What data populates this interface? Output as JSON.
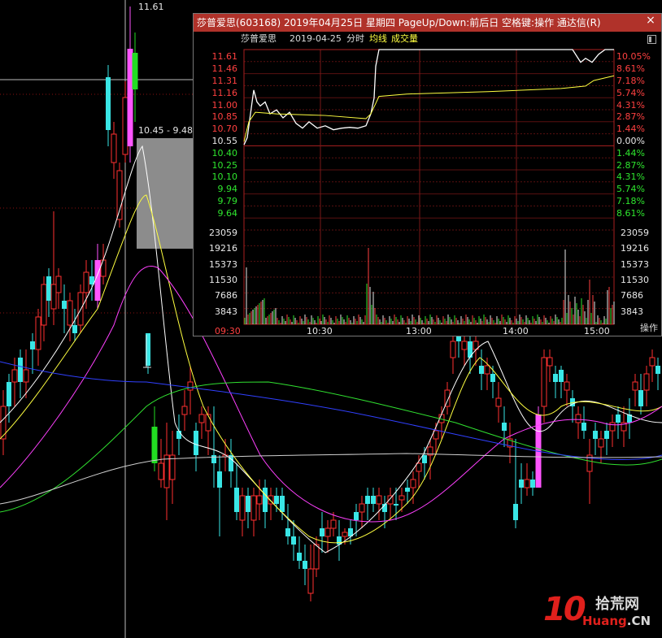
{
  "background_chart": {
    "high_price_label": "11.61",
    "range_label": "10.45 - 9.48"
  },
  "popup": {
    "title": "莎普爱思(603168)  2019年04月25日  星期四  PageUp/Down:前后日  空格键:操作  通达信(R)",
    "close_symbol": "×",
    "stock_name": "莎普爱思",
    "date": "2019-04-25",
    "view": "分时",
    "avg_label": "均线",
    "vol_label": "成交量",
    "price_labels": [
      "11.61",
      "11.46",
      "11.31",
      "11.16",
      "11.00",
      "10.85",
      "10.70",
      "10.55",
      "10.40",
      "10.25",
      "10.10",
      "9.94",
      "9.79",
      "9.64"
    ],
    "pct_labels": [
      "10.05%",
      "8.61%",
      "7.18%",
      "5.74%",
      "4.31%",
      "2.87%",
      "1.44%",
      "0.00%",
      "1.44%",
      "2.87%",
      "4.31%",
      "5.74%",
      "7.18%",
      "8.61%"
    ],
    "volume_labels": [
      "23059",
      "19216",
      "15373",
      "11530",
      "7686",
      "3843"
    ],
    "time_labels": [
      "09:30",
      "10:30",
      "13:00",
      "14:00",
      "15:00"
    ],
    "operate_label": "操作",
    "colors": {
      "up": "#ff4040",
      "down": "#2ee62e",
      "flat": "#e8e8e8",
      "avg": "#ffff40",
      "title_bg": "#b0322a"
    }
  },
  "watermark": {
    "number": "10",
    "text_cn": "拾荒网",
    "url_main": "Huang",
    "url_tld": ".CN"
  },
  "chart_data": {
    "type": "line",
    "title": "莎普爱思(603168) 2019-04-25 分时",
    "prev_close": 10.55,
    "ylim": [
      9.64,
      11.61
    ],
    "x": [
      "09:30",
      "10:30",
      "13:00",
      "14:00",
      "15:00"
    ],
    "series": [
      {
        "name": "price",
        "values": [
          10.41,
          11.1,
          10.8,
          10.62,
          11.61,
          11.61,
          11.61
        ]
      },
      {
        "name": "均线",
        "values": [
          10.45,
          10.82,
          10.78,
          10.74,
          11.15,
          11.25,
          11.3
        ]
      }
    ]
  }
}
